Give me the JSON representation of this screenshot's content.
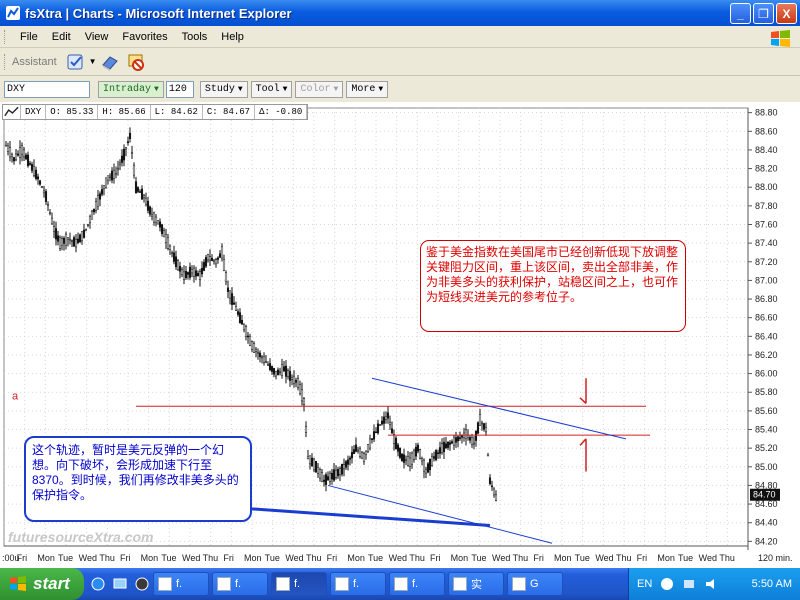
{
  "window": {
    "title": "fsXtra | Charts - Microsoft Internet Explorer",
    "minimize": "_",
    "restore": "❐",
    "close": "X"
  },
  "menu": {
    "items": [
      "File",
      "Edit",
      "View",
      "Favorites",
      "Tools",
      "Help"
    ]
  },
  "assistant": {
    "label": "Assistant"
  },
  "chart_toolbar": {
    "symbol": "DXY",
    "interval": "Intraday",
    "bars": "120",
    "study": "Study",
    "tool": "Tool",
    "color": "Color",
    "more": "More"
  },
  "ohlc": {
    "symbol": "DXY",
    "open": "O: 85.33",
    "high": "H: 85.66",
    "low": "L: 84.62",
    "close": "C: 84.67",
    "delta": "Δ: -0.80"
  },
  "annotations": {
    "red_note": "鉴于美金指数在美国尾市已经创新低现下放调整关键阻力区间，重上该区间，卖出全部非美，作为非美多头的获利保护，站稳区间之上，也可作为短线买进美元的参考位子。",
    "blue_note": "这个轨迹，暂时是美元反弹的一个幻想。向下破坏，会形成加速下行至8370。到时候，我们再修改非美多头的保护指令。",
    "marker_a": "a",
    "watermark": "futuresourceXtra.com"
  },
  "chart_data": {
    "type": "candlestick",
    "yaxis_ticks": [
      "88.80",
      "88.60",
      "88.40",
      "88.20",
      "88.00",
      "87.80",
      "87.60",
      "87.40",
      "87.20",
      "87.00",
      "86.80",
      "86.60",
      "86.40",
      "86.20",
      "86.00",
      "85.80",
      "85.60",
      "85.40",
      "85.20",
      "85.00",
      "84.80",
      "84.60",
      "84.40",
      "84.20"
    ],
    "ylim": [
      84.15,
      88.85
    ],
    "price_tag": "84.70",
    "xaxis_ticks": [
      ":00u",
      "Fri",
      "Mon",
      "Tue",
      "Wed",
      "Thu",
      "Fri",
      "Mon",
      "Tue",
      "Wed",
      "Thu",
      "Fri",
      "Mon",
      "Tue",
      "Wed",
      "Thu",
      "Fri",
      "Mon",
      "Tue",
      "Wed",
      "Thu",
      "Fri",
      "Mon",
      "Tue",
      "Wed",
      "Thu",
      "Fri",
      "Mon",
      "Tue",
      "Wed",
      "Thu",
      "Fri",
      "Mon",
      "Tue",
      "Wed",
      "Thu",
      "120 min."
    ],
    "path_points": [
      {
        "x": 0,
        "y": 88.45
      },
      {
        "x": 8,
        "y": 88.3
      },
      {
        "x": 16,
        "y": 88.4
      },
      {
        "x": 24,
        "y": 88.25
      },
      {
        "x": 32,
        "y": 88.1
      },
      {
        "x": 40,
        "y": 87.9
      },
      {
        "x": 48,
        "y": 87.55
      },
      {
        "x": 54,
        "y": 87.4
      },
      {
        "x": 62,
        "y": 87.45
      },
      {
        "x": 70,
        "y": 87.4
      },
      {
        "x": 78,
        "y": 87.5
      },
      {
        "x": 86,
        "y": 87.7
      },
      {
        "x": 94,
        "y": 87.9
      },
      {
        "x": 102,
        "y": 88.1
      },
      {
        "x": 110,
        "y": 88.15
      },
      {
        "x": 118,
        "y": 88.35
      },
      {
        "x": 124,
        "y": 88.55
      },
      {
        "x": 130,
        "y": 88.0
      },
      {
        "x": 138,
        "y": 87.9
      },
      {
        "x": 146,
        "y": 87.7
      },
      {
        "x": 154,
        "y": 87.6
      },
      {
        "x": 162,
        "y": 87.4
      },
      {
        "x": 170,
        "y": 87.2
      },
      {
        "x": 178,
        "y": 87.05
      },
      {
        "x": 186,
        "y": 87.1
      },
      {
        "x": 194,
        "y": 87.05
      },
      {
        "x": 202,
        "y": 87.25
      },
      {
        "x": 210,
        "y": 87.2
      },
      {
        "x": 216,
        "y": 87.3
      },
      {
        "x": 222,
        "y": 86.9
      },
      {
        "x": 230,
        "y": 86.7
      },
      {
        "x": 238,
        "y": 86.5
      },
      {
        "x": 246,
        "y": 86.3
      },
      {
        "x": 254,
        "y": 86.2
      },
      {
        "x": 262,
        "y": 86.1
      },
      {
        "x": 270,
        "y": 86.0
      },
      {
        "x": 278,
        "y": 86.05
      },
      {
        "x": 286,
        "y": 85.95
      },
      {
        "x": 292,
        "y": 85.9
      },
      {
        "x": 298,
        "y": 85.7
      },
      {
        "x": 302,
        "y": 85.1
      },
      {
        "x": 310,
        "y": 85.0
      },
      {
        "x": 318,
        "y": 84.85
      },
      {
        "x": 326,
        "y": 84.9
      },
      {
        "x": 334,
        "y": 84.95
      },
      {
        "x": 342,
        "y": 85.05
      },
      {
        "x": 350,
        "y": 85.2
      },
      {
        "x": 358,
        "y": 85.1
      },
      {
        "x": 366,
        "y": 85.3
      },
      {
        "x": 374,
        "y": 85.45
      },
      {
        "x": 382,
        "y": 85.55
      },
      {
        "x": 388,
        "y": 85.3
      },
      {
        "x": 396,
        "y": 85.1
      },
      {
        "x": 404,
        "y": 85.05
      },
      {
        "x": 412,
        "y": 85.2
      },
      {
        "x": 420,
        "y": 84.95
      },
      {
        "x": 428,
        "y": 85.1
      },
      {
        "x": 436,
        "y": 85.2
      },
      {
        "x": 444,
        "y": 85.25
      },
      {
        "x": 452,
        "y": 85.3
      },
      {
        "x": 460,
        "y": 85.35
      },
      {
        "x": 468,
        "y": 85.25
      },
      {
        "x": 474,
        "y": 85.5
      },
      {
        "x": 480,
        "y": 85.4
      },
      {
        "x": 484,
        "y": 84.85
      },
      {
        "x": 490,
        "y": 84.67
      }
    ]
  }
}
